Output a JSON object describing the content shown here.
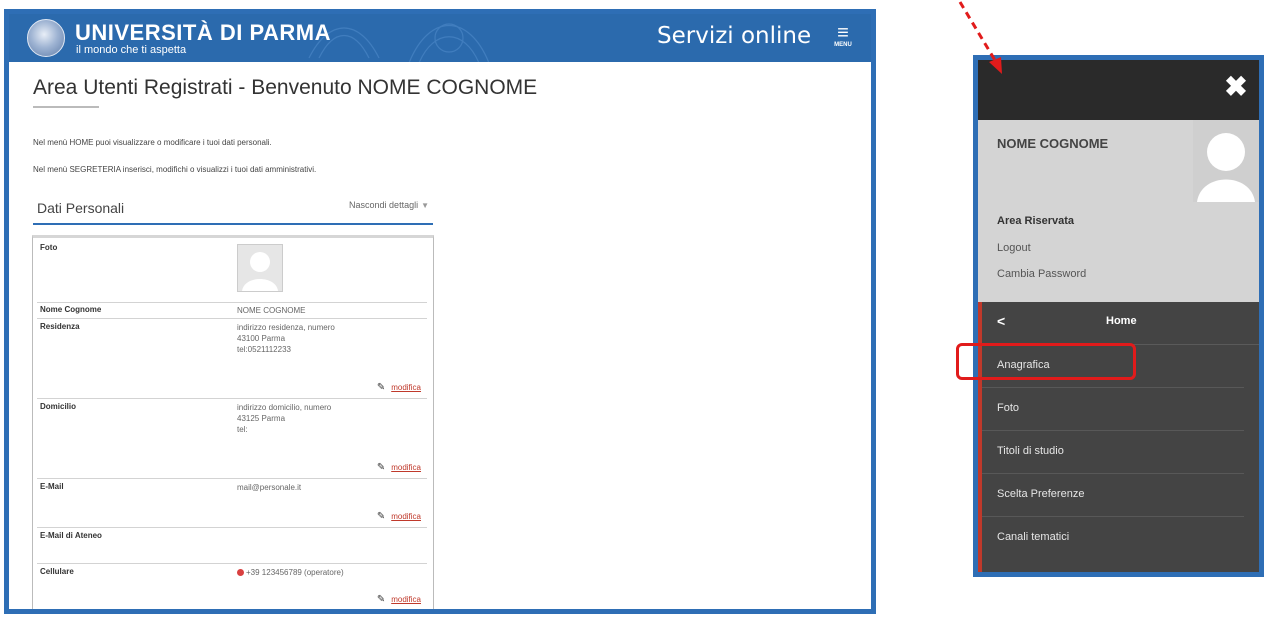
{
  "header": {
    "university": "UNIVERSITÀ DI PARMA",
    "tagline": "il mondo che ti aspetta",
    "service": "Servizi online",
    "menu_label": "MENU",
    "menu_icon": "hamburger-icon",
    "logo_icon": "university-seal-icon",
    "brand_color": "#2b6aad"
  },
  "main": {
    "title": "Area Utenti Registrati - Benvenuto NOME COGNOME",
    "intro_home": "Nel menù HOME puoi visualizzare o modificare i tuoi dati personali.",
    "intro_segreteria": "Nel menù SEGRETERIA inserisci, modifichi o visualizzi i tuoi dati amministrativi.",
    "section_title": "Dati Personali",
    "toggle_label": "Nascondi dettagli",
    "toggle_icon": "caret-down-icon"
  },
  "personal_data": {
    "edit_label": "modifica",
    "edit_icon": "edit-icon",
    "rows": [
      {
        "label": "Foto"
      },
      {
        "label": "Nome Cognome",
        "value": "NOME COGNOME"
      },
      {
        "label": "Residenza",
        "lines": [
          "indirizzo residenza, numero",
          "43100 Parma",
          "tel:0521112233"
        ]
      },
      {
        "label": "Domicilio",
        "lines": [
          "indirizzo domicilio, numero",
          "43125 Parma",
          "tel:"
        ]
      },
      {
        "label": "E-Mail",
        "value": "mail@personale.it"
      },
      {
        "label": "E-Mail di Ateneo",
        "value": ""
      },
      {
        "label": "Cellulare",
        "value": "+39 123456789 (operatore)"
      }
    ]
  },
  "side_menu": {
    "close_icon": "close-icon",
    "user_name": "NOME COGNOME",
    "area_title": "Area Riservata",
    "logout": "Logout",
    "change_password": "Cambia Password",
    "back_icon": "chevron-left-icon",
    "home_label": "Home",
    "items": [
      "Anagrafica",
      "Foto",
      "Titoli di studio",
      "Scelta Preferenze",
      "Canali tematici"
    ],
    "highlighted_item": "Anagrafica",
    "highlight_color": "#e11b1b"
  }
}
